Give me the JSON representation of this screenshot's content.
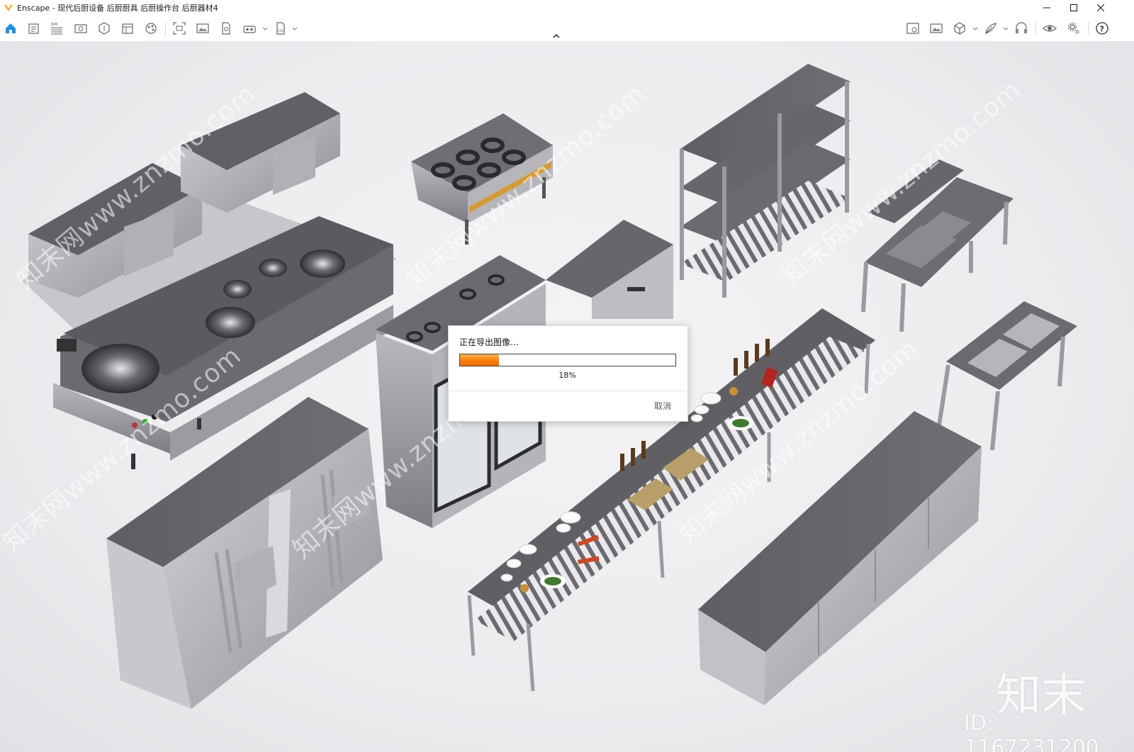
{
  "window": {
    "title": "Enscape - 现代后厨设备 后厨厨具 后厨操作台 后厨器材4"
  },
  "toolbar": {
    "left_icons": [
      "home-icon",
      "document-icon",
      "bim-icon",
      "views-icon",
      "asset-library-icon",
      "material-icon",
      "atmosphere-icon",
      "screenshot-icon",
      "image-icon",
      "export-file-icon",
      "vr-icon",
      "exe-export-icon"
    ],
    "right_icons": [
      "image-compare-icon",
      "gallery-icon",
      "cube-icon",
      "feather-icon",
      "headset-icon",
      "eye-icon",
      "settings-icon",
      "help-icon"
    ],
    "collapse_icon": "chevron-up-icon"
  },
  "dialog": {
    "title": "正在导出图像…",
    "progress": 0.18,
    "progress_label": "18%",
    "cancel_label": "取消"
  },
  "watermark": {
    "site": "知末网www.znzmo.com",
    "brand": "知末",
    "id_text": "ID: 1167231200"
  },
  "colors": {
    "accent": "#ff7a00",
    "home_icon": "#1a8fe3",
    "logo": "#f7a823"
  }
}
